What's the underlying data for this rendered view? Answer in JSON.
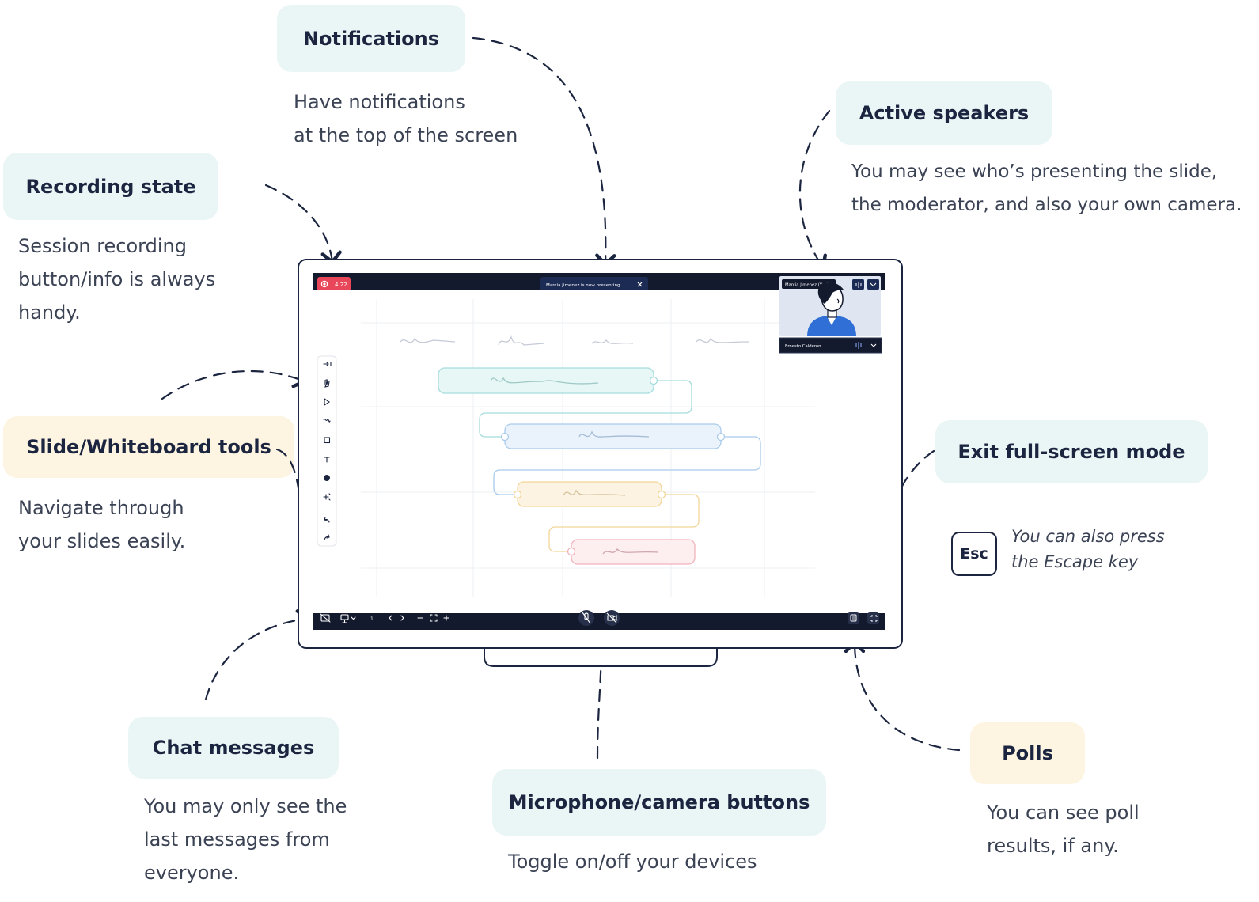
{
  "callouts": {
    "notifications": {
      "title": "Notifications",
      "desc": [
        "Have notifications",
        "at the top of the screen"
      ]
    },
    "recording": {
      "title": "Recording state",
      "desc": [
        "Session recording",
        "button/info is always",
        "handy."
      ]
    },
    "speakers": {
      "title": "Active speakers",
      "desc": [
        "You may see who’s presenting the slide,",
        "the moderator, and also your own camera."
      ]
    },
    "tools": {
      "title": "Slide/Whiteboard tools",
      "desc": [
        "Navigate through",
        "your slides easily."
      ]
    },
    "exit": {
      "title": "Exit full-screen mode",
      "key": "Esc",
      "note": [
        "You can also press",
        "the Escape key"
      ]
    },
    "chat": {
      "title": "Chat messages",
      "desc": [
        "You may only see the",
        "last messages from",
        "everyone."
      ]
    },
    "mic": {
      "title": "Microphone/camera buttons",
      "desc": [
        "Toggle on/off your devices"
      ]
    },
    "polls": {
      "title": "Polls",
      "desc": [
        "You can see poll",
        "results, if any."
      ]
    }
  },
  "screen": {
    "recording_time": "4:22",
    "toast": "Marcia Jimenez is now presenting",
    "camera_self_label": "Marcia Jimenez (You)",
    "camera_other_label": "Ernesto Calderón",
    "page_indicator": "1"
  },
  "icons": [
    "record-icon",
    "close-icon",
    "audio-level-icon",
    "chevron-down-icon",
    "chat-icon",
    "presentation-icon",
    "chevron-left-icon",
    "chevron-right-icon",
    "zoom-out-icon",
    "fit-icon",
    "zoom-in-icon",
    "mic-off-icon",
    "camera-off-icon",
    "poll-icon",
    "exit-fullscreen-icon",
    "pointer-icon",
    "hand-icon",
    "select-icon",
    "pen-icon",
    "shape-icon",
    "text-icon",
    "color-icon",
    "magic-icon",
    "undo-icon",
    "redo-icon"
  ],
  "colors": {
    "dark": "#141a2e",
    "recording": "#e8475a",
    "teal_box": "#eaf6f6",
    "cream_box": "#fdf4e2"
  }
}
